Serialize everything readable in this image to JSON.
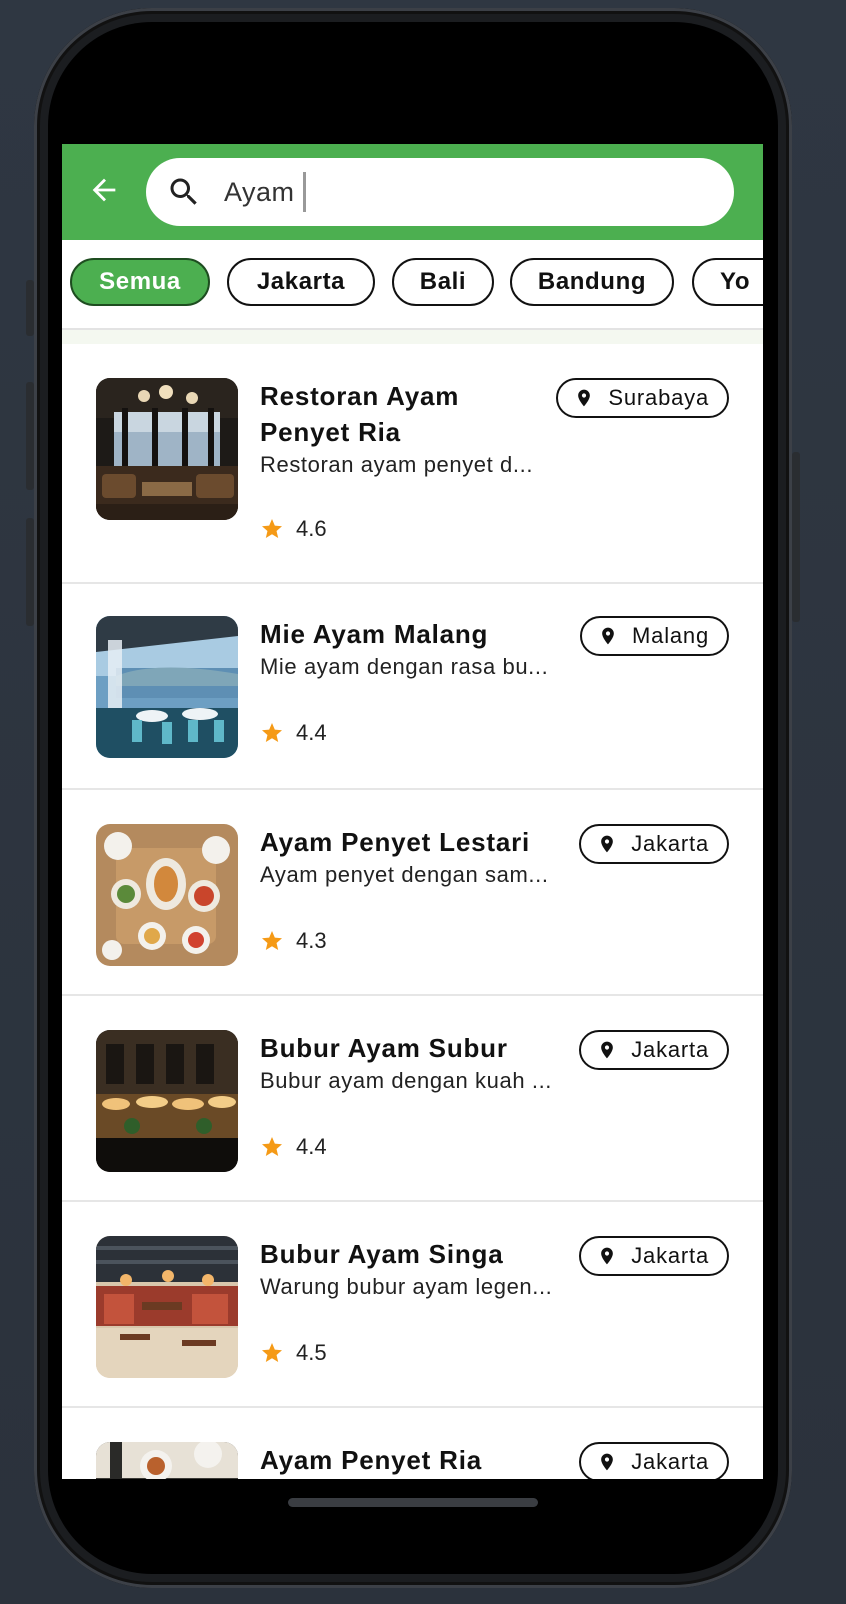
{
  "search": {
    "query": "Ayam"
  },
  "filters": [
    {
      "label": "Semua",
      "active": true
    },
    {
      "label": "Jakarta",
      "active": false
    },
    {
      "label": "Bali",
      "active": false
    },
    {
      "label": "Bandung",
      "active": false
    },
    {
      "label": "Yo",
      "active": false
    }
  ],
  "restaurants": [
    {
      "name": "Restoran Ayam Penyet Ria",
      "description": "Restoran ayam penyet d...",
      "rating": "4.6",
      "location": "Surabaya",
      "image": "restaurant-interior-night"
    },
    {
      "name": "Mie Ayam Malang",
      "description": "Mie ayam dengan rasa bu...",
      "rating": "4.4",
      "location": "Malang",
      "image": "terrace-seaside"
    },
    {
      "name": "Ayam Penyet Lestari",
      "description": "Ayam penyet dengan sam...",
      "rating": "4.3",
      "location": "Jakarta",
      "image": "table-food-overhead"
    },
    {
      "name": "Bubur Ayam Subur",
      "description": "Bubur ayam dengan kuah ...",
      "rating": "4.4",
      "location": "Jakarta",
      "image": "street-cafe-night"
    },
    {
      "name": "Bubur Ayam Singa",
      "description": "Warung bubur ayam legen...",
      "rating": "4.5",
      "location": "Jakarta",
      "image": "industrial-dining-hall"
    },
    {
      "name": "Ayam Penyet Ria",
      "description": "",
      "rating": "",
      "location": "Jakarta",
      "image": "plates-overhead"
    }
  ],
  "colors": {
    "primary": "#4caf50",
    "star": "#f59a16"
  }
}
